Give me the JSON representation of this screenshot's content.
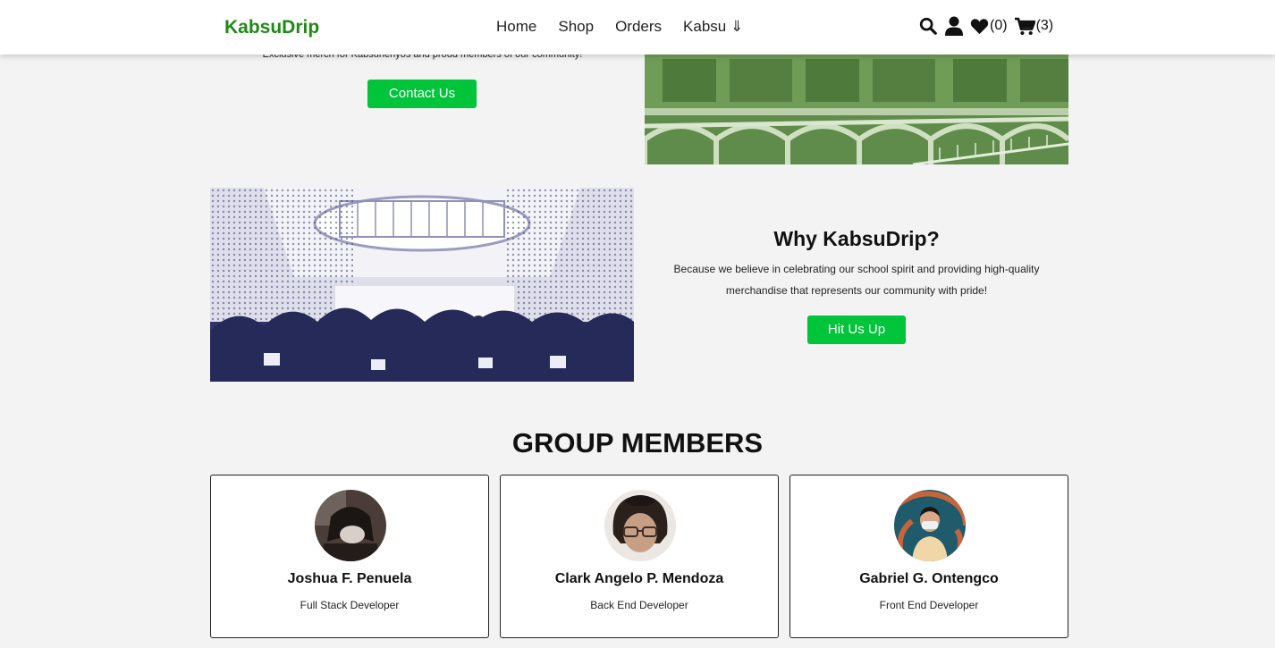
{
  "navbar": {
    "brand": "KabsuDrip",
    "links": [
      "Home",
      "Shop",
      "Orders",
      "Kabsu ⇓"
    ],
    "wishlist_count": "(0)",
    "cart_count": "(3)",
    "icons": [
      "search-icon",
      "user-icon",
      "heart-icon",
      "cart-icon"
    ]
  },
  "hero": {
    "tagline": "Exclusive merch for Kabsuhenyos and proud members of our community!",
    "contact_label": "Contact Us"
  },
  "why": {
    "title": "Why KabsuDrip?",
    "text": "Because we believe in celebrating our school spirit and providing high-quality merchandise that represents our community with pride!",
    "button_label": "Hit Us Up"
  },
  "group": {
    "title": "GROUP MEMBERS",
    "members": [
      {
        "name": "Joshua F. Penuela",
        "role": "Full Stack Developer"
      },
      {
        "name": "Clark Angelo P. Mendoza",
        "role": "Back End Developer"
      },
      {
        "name": "Gabriel G. Ontengco",
        "role": "Front End Developer"
      }
    ]
  },
  "colors": {
    "brand": "#1e8a14",
    "button": "#00c43a",
    "background": "#f3f3f3"
  }
}
